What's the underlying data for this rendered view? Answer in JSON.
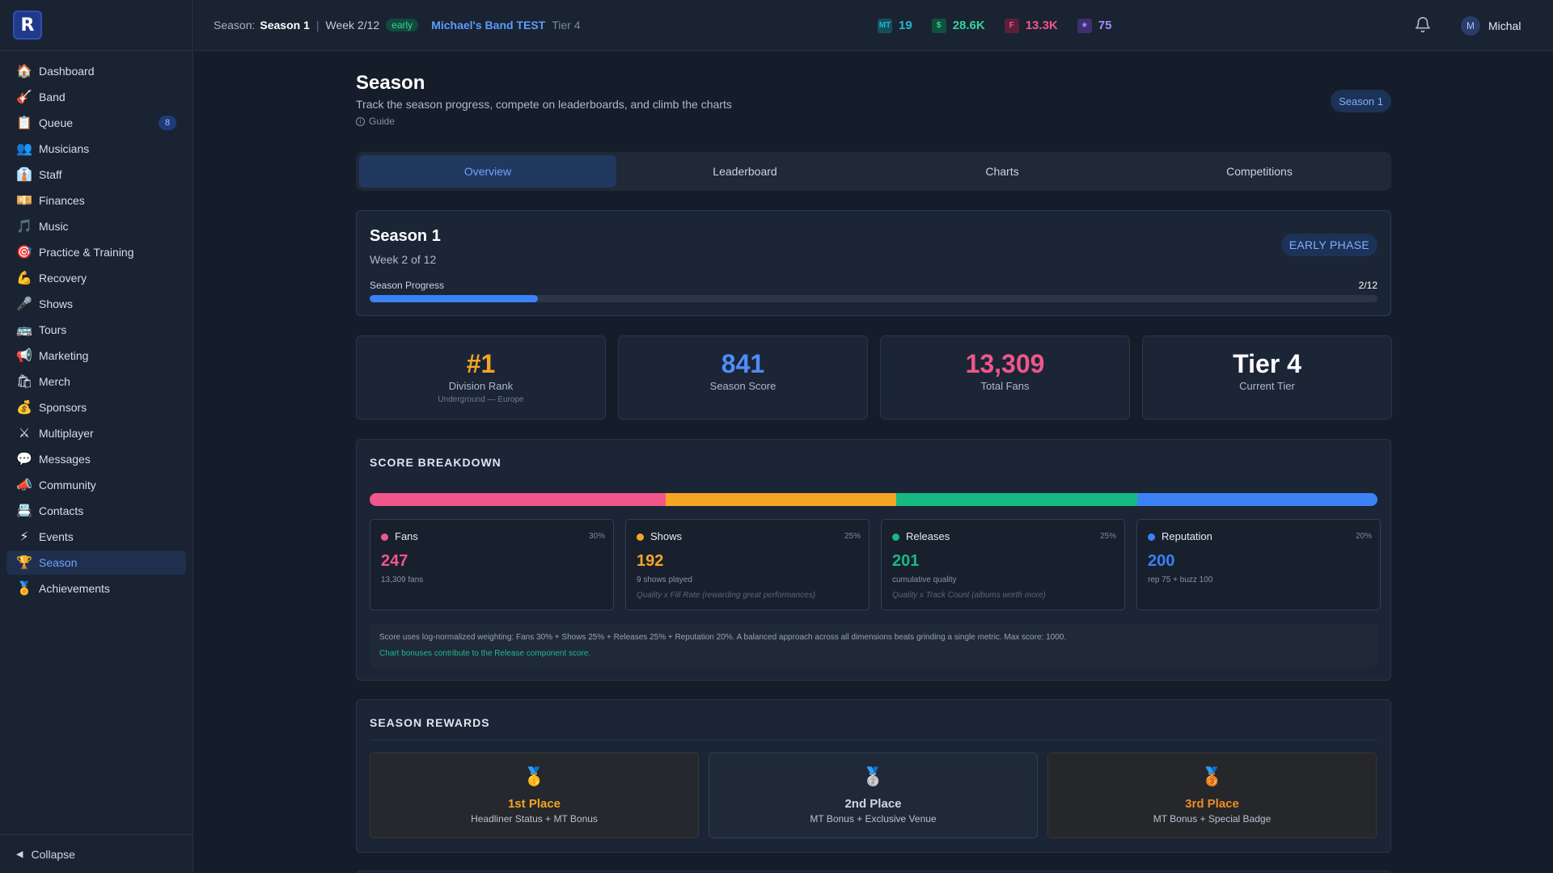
{
  "app": {
    "logo_letter": "R"
  },
  "sidebar": {
    "items": [
      {
        "label": "Dashboard",
        "icon": "🏠",
        "icon_name": "home-icon"
      },
      {
        "label": "Band",
        "icon": "🎸",
        "icon_name": "guitar-icon"
      },
      {
        "label": "Queue",
        "icon": "📋",
        "icon_name": "clipboard-icon",
        "badge": "8"
      },
      {
        "label": "Musicians",
        "icon": "👥",
        "icon_name": "people-icon"
      },
      {
        "label": "Staff",
        "icon": "👔",
        "icon_name": "tie-icon"
      },
      {
        "label": "Finances",
        "icon": "💴",
        "icon_name": "money-icon"
      },
      {
        "label": "Music",
        "icon": "🎵",
        "icon_name": "music-note-icon"
      },
      {
        "label": "Practice & Training",
        "icon": "🎯",
        "icon_name": "target-icon"
      },
      {
        "label": "Recovery",
        "icon": "💪",
        "icon_name": "muscle-icon"
      },
      {
        "label": "Shows",
        "icon": "🎤",
        "icon_name": "microphone-icon"
      },
      {
        "label": "Tours",
        "icon": "🚌",
        "icon_name": "bus-icon"
      },
      {
        "label": "Marketing",
        "icon": "📢",
        "icon_name": "megaphone-icon"
      },
      {
        "label": "Merch",
        "icon": "🛍",
        "icon_name": "shopping-bag-icon"
      },
      {
        "label": "Sponsors",
        "icon": "💰",
        "icon_name": "money-bag-icon"
      },
      {
        "label": "Multiplayer",
        "icon": "⚔",
        "icon_name": "swords-icon"
      },
      {
        "label": "Messages",
        "icon": "💬",
        "icon_name": "speech-bubble-icon"
      },
      {
        "label": "Community",
        "icon": "📣",
        "icon_name": "community-megaphone-icon"
      },
      {
        "label": "Contacts",
        "icon": "📇",
        "icon_name": "card-index-icon"
      },
      {
        "label": "Events",
        "icon": "⚡",
        "icon_name": "lightning-icon"
      },
      {
        "label": "Season",
        "icon": "🏆",
        "icon_name": "trophy-icon",
        "active": true
      },
      {
        "label": "Achievements",
        "icon": "🏅",
        "icon_name": "medal-icon"
      }
    ],
    "collapse_label": "Collapse"
  },
  "topbar": {
    "season_prefix": "Season:",
    "season_name": "Season 1",
    "separator": "|",
    "week": "Week 2/12",
    "phase_badge": "early",
    "band_name": "Michael's Band TEST",
    "tier": "Tier 4",
    "stats": [
      {
        "icon_text": "MT",
        "value": "19",
        "color": "#22b8cf",
        "icon_bg": "#164e5c"
      },
      {
        "icon_text": "$",
        "value": "28.6K",
        "color": "#34d399",
        "icon_bg": "#11503a"
      },
      {
        "icon_text": "F",
        "value": "13.3K",
        "color": "#f0568a",
        "icon_bg": "#5c1f3a"
      },
      {
        "icon_text": "★",
        "value": "75",
        "color": "#a78bfa",
        "icon_bg": "#3d2f70"
      }
    ],
    "user_initial": "M",
    "user_name": "Michal"
  },
  "page": {
    "title": "Season",
    "subtitle": "Track the season progress, compete on leaderboards, and climb the charts",
    "guide": "Guide",
    "season_pill": "Season 1"
  },
  "tabs": [
    {
      "label": "Overview",
      "active": true
    },
    {
      "label": "Leaderboard"
    },
    {
      "label": "Charts"
    },
    {
      "label": "Competitions"
    }
  ],
  "season_card": {
    "title": "Season 1",
    "week": "Week 2 of 12",
    "phase": "EARLY PHASE",
    "progress_label": "Season Progress",
    "progress_text": "2/12",
    "progress_fraction": 0.1667
  },
  "kpis": [
    {
      "value": "#1",
      "label": "Division Rank",
      "sub": "Underground — Europe",
      "color": "#f5a524"
    },
    {
      "value": "841",
      "label": "Season Score",
      "sub": "",
      "color": "#4f8dfb"
    },
    {
      "value": "13,309",
      "label": "Total Fans",
      "sub": "",
      "color": "#f0568a"
    },
    {
      "value": "Tier 4",
      "label": "Current Tier",
      "sub": "",
      "color": "#ffffff"
    }
  ],
  "breakdown": {
    "title": "SCORE BREAKDOWN",
    "components": [
      {
        "name": "Fans",
        "weight": "30%",
        "score": "247",
        "desc": "13,309 fans",
        "note": "",
        "color": "#f0568a",
        "share": 247
      },
      {
        "name": "Shows",
        "weight": "25%",
        "score": "192",
        "desc": "9 shows played",
        "note": "Quality x Fill Rate (rewarding great performances)",
        "color": "#f5a524",
        "share": 192
      },
      {
        "name": "Releases",
        "weight": "25%",
        "score": "201",
        "desc": "cumulative quality",
        "note": "Quality x Track Count (albums worth more)",
        "color": "#16b981",
        "share": 201
      },
      {
        "name": "Reputation",
        "weight": "20%",
        "score": "200",
        "desc": "rep 75 + buzz 100",
        "note": "",
        "color": "#3b82f6",
        "share": 200
      }
    ],
    "note_line1": "Score uses log-normalized weighting: Fans 30% + Shows 25% + Releases 25% + Reputation 20%. A balanced approach across all dimensions beats grinding a single metric. Max score: 1000.",
    "note_line2": "Chart bonuses contribute to the Release component score."
  },
  "rewards": {
    "title": "SEASON REWARDS",
    "items": [
      {
        "icon": "🥇",
        "name": "1st Place",
        "desc": "Headliner Status + MT Bonus",
        "color": "#f5a524"
      },
      {
        "icon": "🥈",
        "name": "2nd Place",
        "desc": "MT Bonus + Exclusive Venue",
        "color": "#cfd6e2"
      },
      {
        "icon": "🥉",
        "name": "3rd Place",
        "desc": "MT Bonus + Special Badge",
        "color": "#f08a24"
      }
    ]
  }
}
